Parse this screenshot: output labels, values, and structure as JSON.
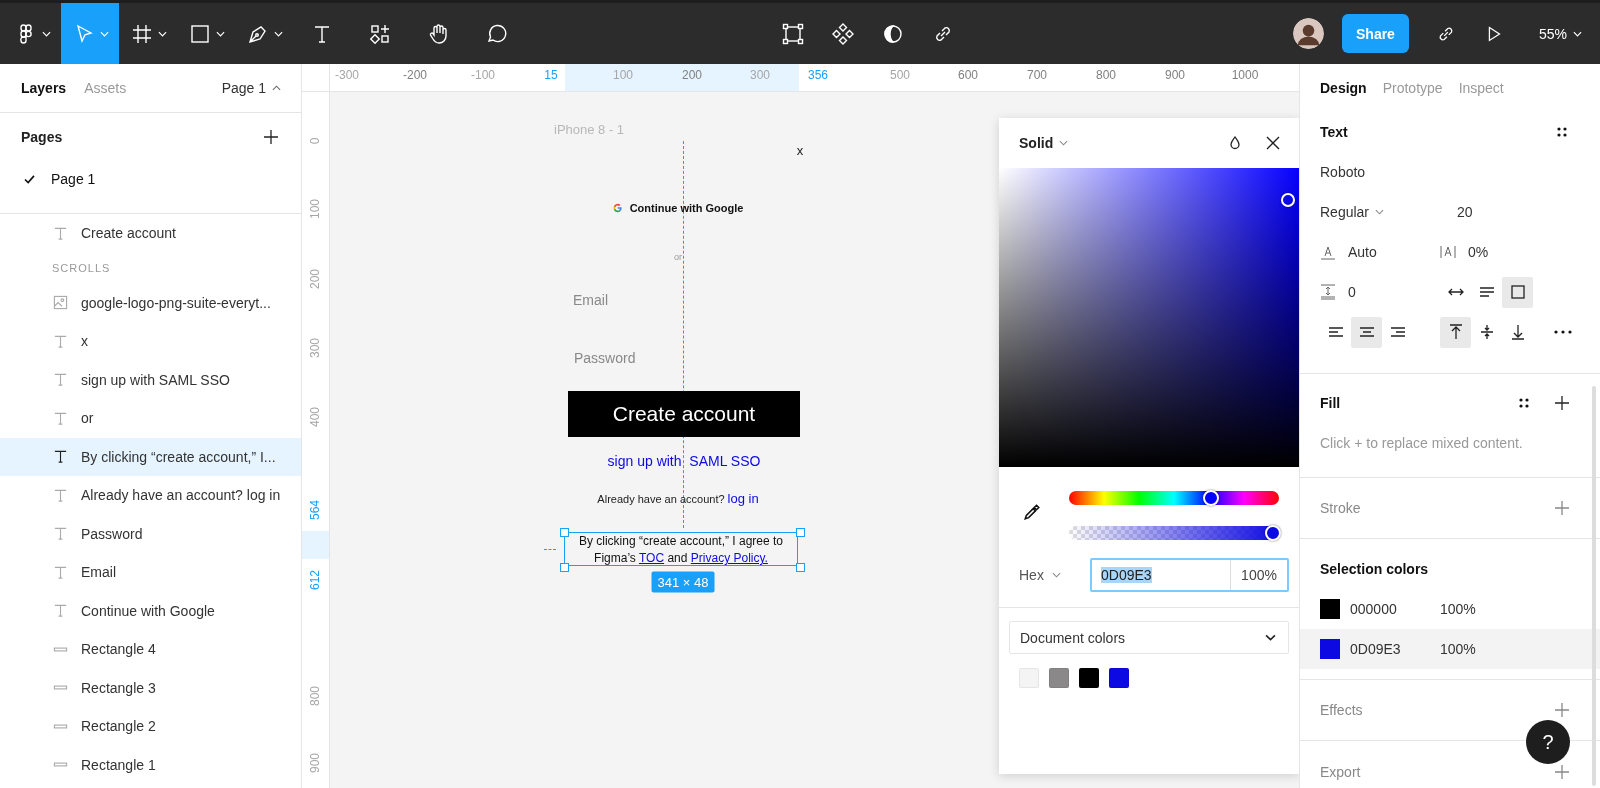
{
  "toolbar": {
    "tools": [
      {
        "kind": "main-menu",
        "selected": false,
        "caret": true
      },
      {
        "kind": "move",
        "selected": true,
        "caret": true
      },
      {
        "kind": "frame",
        "selected": false,
        "caret": true
      },
      {
        "kind": "shape",
        "selected": false,
        "caret": true
      },
      {
        "kind": "pen",
        "selected": false,
        "caret": true
      },
      {
        "kind": "text",
        "selected": false,
        "caret": false
      },
      {
        "kind": "resources",
        "selected": false,
        "caret": false
      },
      {
        "kind": "hand",
        "selected": false,
        "caret": false
      },
      {
        "kind": "comment",
        "selected": false,
        "caret": false
      }
    ],
    "actions": [
      {
        "kind": "edit-object"
      },
      {
        "kind": "component"
      },
      {
        "kind": "mask"
      },
      {
        "kind": "link"
      }
    ],
    "share_button": "Share",
    "zoom": "55%"
  },
  "left_panel": {
    "tabs": [
      {
        "label": "Layers",
        "selected": true
      },
      {
        "label": "Assets",
        "selected": false
      }
    ],
    "page_menu": "Page 1",
    "pages_title": "Pages",
    "pages": [
      {
        "label": "Page 1",
        "selected": true
      }
    ],
    "layers": [
      {
        "kind": "text",
        "label": "Create account",
        "selected": false
      },
      {
        "kind": "section",
        "label": "SCROLLS",
        "selected": false
      },
      {
        "kind": "image",
        "label": "google-logo-png-suite-everyt...",
        "selected": false
      },
      {
        "kind": "text",
        "label": "x",
        "selected": false
      },
      {
        "kind": "text",
        "label": "sign up with SAML SSO",
        "selected": false
      },
      {
        "kind": "text",
        "label": "or",
        "selected": false
      },
      {
        "kind": "text",
        "label": "By clicking “create account,” I...",
        "selected": true
      },
      {
        "kind": "text",
        "label": "Already have an account? log in",
        "selected": false
      },
      {
        "kind": "text",
        "label": "Password",
        "selected": false
      },
      {
        "kind": "text",
        "label": "Email",
        "selected": false
      },
      {
        "kind": "text",
        "label": "Continue with Google",
        "selected": false
      },
      {
        "kind": "rectangle",
        "label": "Rectangle 4",
        "selected": false
      },
      {
        "kind": "rectangle",
        "label": "Rectangle 3",
        "selected": false
      },
      {
        "kind": "rectangle",
        "label": "Rectangle 2",
        "selected": false
      },
      {
        "kind": "rectangle",
        "label": "Rectangle 1",
        "selected": false
      }
    ]
  },
  "rulers": {
    "horizontal": [
      {
        "label": "-300",
        "kind": "faint"
      },
      {
        "label": "-200",
        "kind": "normal"
      },
      {
        "label": "-100",
        "kind": "faint"
      },
      {
        "label": "15",
        "kind": "accent"
      },
      {
        "label": "100",
        "kind": "faint"
      },
      {
        "label": "200",
        "kind": "normal"
      },
      {
        "label": "300",
        "kind": "faint"
      },
      {
        "label": "356",
        "kind": "accent"
      },
      {
        "label": "500",
        "kind": "faint"
      },
      {
        "label": "600",
        "kind": "normal"
      },
      {
        "label": "700",
        "kind": "normal"
      },
      {
        "label": "800",
        "kind": "normal"
      },
      {
        "label": "900",
        "kind": "normal"
      },
      {
        "label": "1000",
        "kind": "normal"
      }
    ],
    "vertical": [
      {
        "label": "0",
        "kind": "faint"
      },
      {
        "label": "100",
        "kind": "faint"
      },
      {
        "label": "200",
        "kind": "faint"
      },
      {
        "label": "300",
        "kind": "faint"
      },
      {
        "label": "400",
        "kind": "faint"
      },
      {
        "label": "564",
        "kind": "accent"
      },
      {
        "label": "612",
        "kind": "accent"
      },
      {
        "label": "800",
        "kind": "faint"
      },
      {
        "label": "900",
        "kind": "faint"
      }
    ]
  },
  "canvas": {
    "frame_name": "iPhone 8 - 1",
    "close_mark": "x",
    "google_button": "Continue with Google",
    "divider_text": "or",
    "email_label": "Email",
    "password_label": "Password",
    "create_button": "Create account",
    "sso_link": "sign up with  SAML SSO",
    "login_prompt": "Already have an account?",
    "login_link": "log in",
    "terms": [
      {
        "kind": "plain",
        "text": "By clicking “create account,” I agree to Figma’s "
      },
      {
        "kind": "link",
        "text": "TOC"
      },
      {
        "kind": "plain",
        "text": " and "
      },
      {
        "kind": "link",
        "text": "Privacy Policy."
      }
    ],
    "selection_size": "341 × 48"
  },
  "color_picker": {
    "fill_type": "Solid",
    "hue": {
      "level": 0.67
    },
    "opacity": {
      "level": 1
    },
    "format": "Hex",
    "hex": "0D09E3",
    "alpha": "100%",
    "library": "Document colors",
    "swatches": [
      {
        "color": "#f4f4f4"
      },
      {
        "color": "#8a8888"
      },
      {
        "color": "#000000"
      },
      {
        "color": "#0d09e3"
      }
    ]
  },
  "right_panel": {
    "tabs": [
      {
        "label": "Design",
        "selected": true
      },
      {
        "label": "Prototype",
        "selected": false
      },
      {
        "label": "Inspect",
        "selected": false
      }
    ],
    "text": {
      "title": "Text",
      "font": "Roboto",
      "style": "Regular",
      "size": "20",
      "line_height": "Auto",
      "letter_spacing": "0%",
      "paragraph_spacing": "0",
      "resizing": [
        {
          "kind": "auto-width",
          "selected": false
        },
        {
          "kind": "auto-height",
          "selected": false
        },
        {
          "kind": "fixed",
          "selected": true
        }
      ],
      "align": [
        {
          "kind": "left",
          "selected": false
        },
        {
          "kind": "center",
          "selected": true
        },
        {
          "kind": "right",
          "selected": false
        }
      ],
      "valign": [
        {
          "kind": "top",
          "selected": true
        },
        {
          "kind": "middle",
          "selected": false
        },
        {
          "kind": "bottom",
          "selected": false
        }
      ]
    },
    "fill": {
      "title": "Fill",
      "hint": "Click + to replace mixed content."
    },
    "stroke": "Stroke",
    "selection_colors": {
      "title": "Selection colors",
      "items": [
        {
          "hex": "000000",
          "opacity": "100%",
          "color": "#000000",
          "selected": false
        },
        {
          "hex": "0D09E3",
          "opacity": "100%",
          "color": "#0d09e3",
          "selected": true
        }
      ]
    },
    "effects": "Effects",
    "export": "Export",
    "help_button": "?"
  }
}
